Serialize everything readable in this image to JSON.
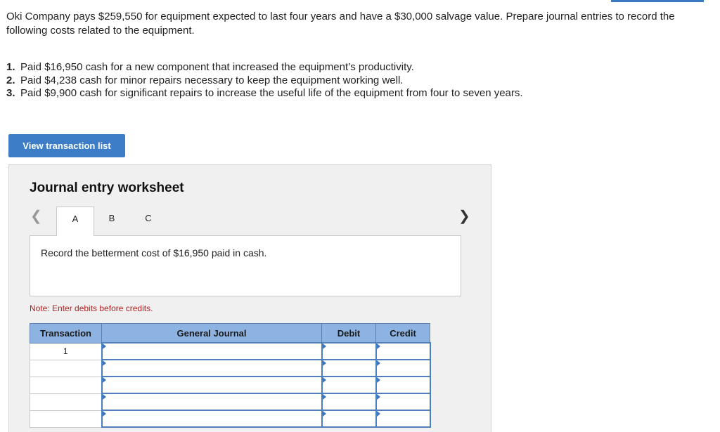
{
  "intro": "Oki Company pays $259,550 for equipment expected to last four years and have a $30,000 salvage value. Prepare journal entries to record the following costs related to the equipment.",
  "requirements": [
    {
      "num": "1.",
      "text": "Paid $16,950 cash for a new component that increased the equipment’s productivity."
    },
    {
      "num": "2.",
      "text": "Paid $4,238 cash for minor repairs necessary to keep the equipment working well."
    },
    {
      "num": "3.",
      "text": "Paid $9,900 cash for significant repairs to increase the useful life of the equipment from four to seven years."
    }
  ],
  "view_button": "View transaction list",
  "worksheet": {
    "title": "Journal entry worksheet",
    "prev_icon": "chevron-left-icon",
    "next_icon": "chevron-right-icon",
    "tabs": [
      "A",
      "B",
      "C"
    ],
    "active_tab": "A",
    "instruction": "Record the betterment cost of $16,950 paid in cash.",
    "note": "Note: Enter debits before credits.",
    "table": {
      "headers": [
        "Transaction",
        "General Journal",
        "Debit",
        "Credit"
      ],
      "rows": [
        {
          "transaction": "1",
          "account": "",
          "debit": "",
          "credit": ""
        },
        {
          "transaction": "",
          "account": "",
          "debit": "",
          "credit": ""
        },
        {
          "transaction": "",
          "account": "",
          "debit": "",
          "credit": ""
        },
        {
          "transaction": "",
          "account": "",
          "debit": "",
          "credit": ""
        },
        {
          "transaction": "",
          "account": "",
          "debit": "",
          "credit": ""
        }
      ]
    }
  },
  "colors": {
    "accent": "#3d7cc6",
    "table_header": "#8db3e2",
    "note": "#b22222"
  }
}
